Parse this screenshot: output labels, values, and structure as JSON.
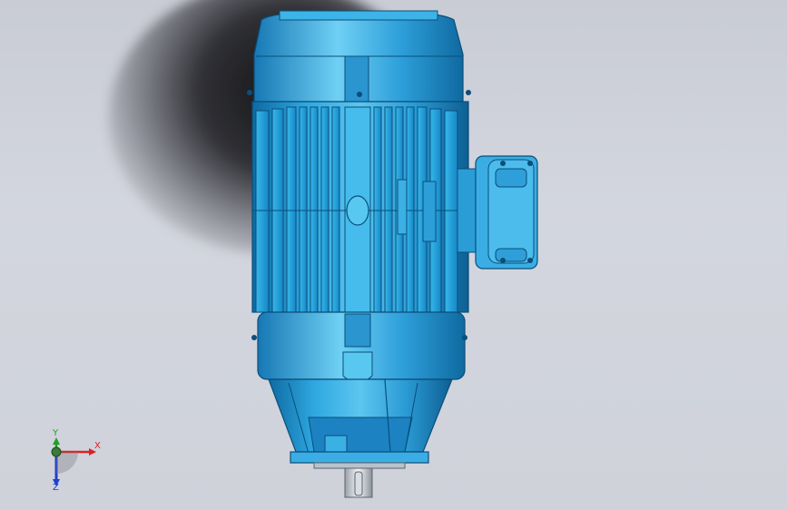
{
  "colors": {
    "background": "#cfd2da",
    "motor_body": "#2a9fd8",
    "motor_highlight": "#7fd6f5",
    "motor_dark": "#0b5a8c",
    "axis_x": "#e02020",
    "axis_y": "#20a020",
    "axis_z": "#2040d0"
  },
  "triad": {
    "x_label": "X",
    "y_label": "Y",
    "z_label": "Z"
  },
  "model": {
    "part": "electric-motor",
    "orientation": "vertical"
  }
}
